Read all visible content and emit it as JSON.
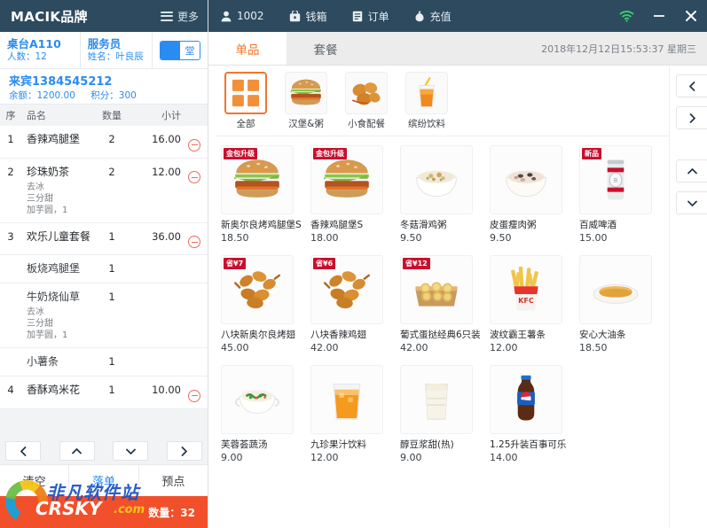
{
  "brand": {
    "logo_text": "MACIK品牌",
    "more_label": "更多",
    "menu_icon": "hamburger-icon"
  },
  "table_info": {
    "table_label": "桌台A110",
    "people_label": "人数：12",
    "waiter_label": "服务员",
    "waiter_name": "姓名：叶良辰",
    "dine_mode": "堂"
  },
  "guest": {
    "name": "来宾1384545212",
    "balance": "余额：1200.00",
    "points": "积分：300"
  },
  "order_table": {
    "headers": {
      "index": "序",
      "name": "品名",
      "qty": "数量",
      "subtotal": "小计"
    },
    "rows": [
      {
        "index": "1",
        "name": "香辣鸡腿堡",
        "qty": "2",
        "subtotal": "16.00",
        "options": [],
        "deletable": true,
        "is_sub": false
      },
      {
        "index": "2",
        "name": "珍珠奶茶",
        "qty": "2",
        "subtotal": "12.00",
        "options": [
          "去冰",
          "三分甜",
          "加芋圆，1"
        ],
        "deletable": true,
        "is_sub": false
      },
      {
        "index": "3",
        "name": "欢乐儿童套餐",
        "qty": "1",
        "subtotal": "36.00",
        "options": [],
        "deletable": true,
        "is_sub": false
      },
      {
        "index": "",
        "name": "板烧鸡腿堡",
        "qty": "1",
        "subtotal": "",
        "options": [],
        "deletable": false,
        "is_sub": true
      },
      {
        "index": "",
        "name": "牛奶烧仙草",
        "qty": "1",
        "subtotal": "",
        "options": [
          "去冰",
          "三分甜",
          "加芋圆，1"
        ],
        "deletable": false,
        "is_sub": true
      },
      {
        "index": "",
        "name": "小薯条",
        "qty": "1",
        "subtotal": "",
        "options": [],
        "deletable": false,
        "is_sub": true
      },
      {
        "index": "4",
        "name": "香酥鸡米花",
        "qty": "1",
        "subtotal": "10.00",
        "options": [],
        "deletable": true,
        "is_sub": false
      }
    ]
  },
  "left_nav": {
    "prev_icon": "chevron-left-icon",
    "up_icon": "chevron-up-icon",
    "down_icon": "chevron-down-icon",
    "next_icon": "chevron-right-icon"
  },
  "left_actions": [
    {
      "label": "清空",
      "accent": false
    },
    {
      "label": "落单",
      "accent": true
    },
    {
      "label": "预点",
      "accent": false
    }
  ],
  "left_total": {
    "quantity_label": "数量：32"
  },
  "watermark": {
    "line1": "非凡软件站",
    "line2": "CRSKY",
    "line3": ".com"
  },
  "top_bar": {
    "items": [
      {
        "icon": "user-icon",
        "label": "1002"
      },
      {
        "icon": "cashbox-icon",
        "label": "钱箱"
      },
      {
        "icon": "order-icon",
        "label": "订单"
      },
      {
        "icon": "recharge-icon",
        "label": "充值"
      }
    ],
    "wifi_icon": "wifi-icon",
    "minimize_icon": "minimize-icon",
    "close_icon": "close-icon",
    "wifi_color": "#3ad16a"
  },
  "tabs": [
    {
      "label": "单品",
      "active": true
    },
    {
      "label": "套餐",
      "active": false
    }
  ],
  "clock": "2018年12月12日15:53:37  星期三",
  "categories": [
    {
      "label": "全部",
      "icon": "grid-icon",
      "active": true
    },
    {
      "label": "汉堡&粥",
      "icon": "burger-icon",
      "active": false
    },
    {
      "label": "小食配餐",
      "icon": "chicken-icon",
      "active": false
    },
    {
      "label": "缤纷饮料",
      "icon": "juice-icon",
      "active": false
    }
  ],
  "products": [
    [
      {
        "name": "新奥尔良烤鸡腿堡S",
        "price": "18.50",
        "badge": "金包升级",
        "badge_style": "red",
        "icon": "burger-icon"
      },
      {
        "name": "香辣鸡腿堡S",
        "price": "18.00",
        "badge": "金包升级",
        "badge_style": "red",
        "icon": "burger-icon"
      },
      {
        "name": "冬菇滑鸡粥",
        "price": "9.50",
        "badge": "",
        "badge_style": "",
        "icon": "porridge-icon"
      },
      {
        "name": "皮蛋瘦肉粥",
        "price": "9.50",
        "badge": "",
        "badge_style": "",
        "icon": "porridge-dark-icon"
      },
      {
        "name": "百威啤酒",
        "price": "15.00",
        "badge": "新品",
        "badge_style": "red",
        "icon": "beer-can-icon"
      }
    ],
    [
      {
        "name": "八块新奥尔良烤翅",
        "price": "45.00",
        "badge": "省¥7",
        "badge_style": "red",
        "icon": "wings-icon"
      },
      {
        "name": "八块香辣鸡翅",
        "price": "42.00",
        "badge": "省¥6",
        "badge_style": "red",
        "icon": "wings-icon"
      },
      {
        "name": "葡式蛋挞经典6只装",
        "price": "42.00",
        "badge": "省¥12",
        "badge_style": "red",
        "icon": "egg-tart-icon"
      },
      {
        "name": "波纹霸王薯条",
        "price": "12.00",
        "badge": "",
        "badge_style": "",
        "icon": "fries-icon"
      },
      {
        "name": "安心大油条",
        "price": "18.50",
        "badge": "",
        "badge_style": "",
        "icon": "youtiao-icon"
      }
    ],
    [
      {
        "name": "芙蓉荟蔬汤",
        "price": "9.00",
        "badge": "",
        "badge_style": "",
        "icon": "soup-icon"
      },
      {
        "name": "九珍果汁饮料",
        "price": "12.00",
        "badge": "",
        "badge_style": "",
        "icon": "juice-glass-icon"
      },
      {
        "name": "醇豆浆甜(热)",
        "price": "9.00",
        "badge": "",
        "badge_style": "",
        "icon": "soymilk-icon"
      },
      {
        "name": "1.25升装百事可乐",
        "price": "14.00",
        "badge": "",
        "badge_style": "",
        "icon": "cola-bottle-icon"
      }
    ]
  ],
  "side_nav": {
    "prev_icon": "chevron-left-icon",
    "next_icon": "chevron-right-icon",
    "up_icon": "chevron-up-icon",
    "down_icon": "chevron-down-icon"
  }
}
